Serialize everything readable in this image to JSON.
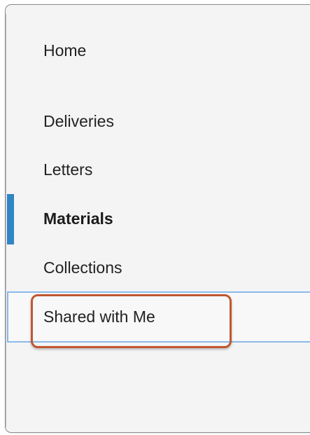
{
  "sidebar": {
    "items": [
      {
        "label": "Home",
        "active": false
      },
      {
        "label": "Deliveries",
        "active": false
      },
      {
        "label": "Letters",
        "active": false
      },
      {
        "label": "Materials",
        "active": true
      },
      {
        "label": "Collections",
        "active": false
      },
      {
        "label": "Shared with Me",
        "active": false,
        "highlighted": true
      }
    ]
  },
  "colors": {
    "active_indicator": "#2f86c2",
    "annotation_border": "#c1572f",
    "focus_row_border": "#8ab9ec",
    "panel_background": "#f4f4f4"
  }
}
